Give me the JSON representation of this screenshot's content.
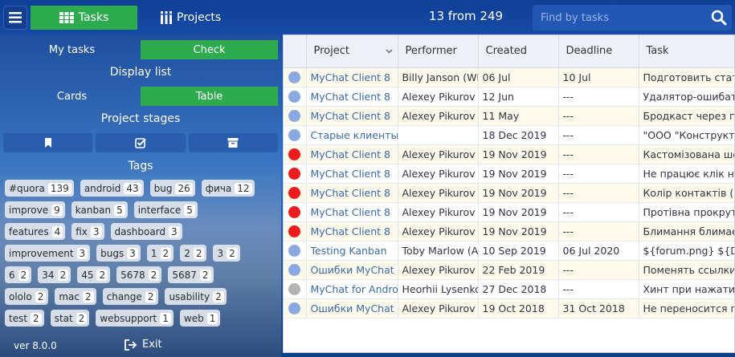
{
  "topbar": {
    "tasks_label": "Tasks",
    "projects_label": "Projects",
    "counter": "13 from 249",
    "search_placeholder": "Find by tasks"
  },
  "sidebar": {
    "my_tasks": "My tasks",
    "check": "Check",
    "display_list": "Display list",
    "cards": "Cards",
    "table": "Table",
    "project_stages": "Project stages",
    "tags_title": "Tags",
    "version": "ver 8.0.0",
    "exit": "Exit"
  },
  "tags": [
    [
      {
        "name": "#quora",
        "count": "139"
      },
      {
        "name": "android",
        "count": "43"
      },
      {
        "name": "bug",
        "count": "26"
      },
      {
        "name": "фича",
        "count": "12"
      }
    ],
    [
      {
        "name": "improve",
        "count": "9"
      },
      {
        "name": "kanban",
        "count": "5"
      },
      {
        "name": "interface",
        "count": "5"
      }
    ],
    [
      {
        "name": "features",
        "count": "4"
      },
      {
        "name": "fix",
        "count": "3"
      },
      {
        "name": "dashboard",
        "count": "3"
      }
    ],
    [
      {
        "name": "improvement",
        "count": "3"
      },
      {
        "name": "bugs",
        "count": "3"
      },
      {
        "name": "1",
        "count": "2"
      },
      {
        "name": "2",
        "count": "2"
      },
      {
        "name": "3",
        "count": "2"
      }
    ],
    [
      {
        "name": "6",
        "count": "2"
      },
      {
        "name": "34",
        "count": "2"
      },
      {
        "name": "45",
        "count": "2"
      },
      {
        "name": "5678",
        "count": "2"
      },
      {
        "name": "5687",
        "count": "2"
      }
    ],
    [
      {
        "name": "ololo",
        "count": "2"
      },
      {
        "name": "mac",
        "count": "2"
      },
      {
        "name": "change",
        "count": "2"
      },
      {
        "name": "usability",
        "count": "2"
      }
    ],
    [
      {
        "name": "test",
        "count": "2"
      },
      {
        "name": "stat",
        "count": "2"
      },
      {
        "name": "websupport",
        "count": "1"
      },
      {
        "name": "web",
        "count": "1"
      }
    ]
  ],
  "table": {
    "columns": [
      "Project",
      "Performer",
      "Created",
      "Deadline",
      "Task"
    ],
    "rows": [
      {
        "status": "#8aa9e0",
        "project": "MyChat Client 8",
        "performer": "Billy Janson (WE",
        "created": "06 Jul",
        "deadline": "10 Jul",
        "task": "Подготовить стат"
      },
      {
        "status": "#8aa9e0",
        "project": "MyChat Client 8",
        "performer": "Alexey Pikurov",
        "created": "12 Jun",
        "deadline": "---",
        "task": "Удалятор-ошибат"
      },
      {
        "status": "#8aa9e0",
        "project": "MyChat Client 8",
        "performer": "Alexey Pikurov",
        "created": "11 May",
        "deadline": "---",
        "task": "Бродкаст через п"
      },
      {
        "status": "#8aa9e0",
        "project": "Старые клиенты,",
        "performer": "",
        "created": "18 Dec 2019",
        "deadline": "---",
        "task": "\"ООО \"Конструкти"
      },
      {
        "status": "#ee1c1c",
        "project": "MyChat Client 8",
        "performer": "Alexey Pikurov",
        "created": "19 Nov 2019",
        "deadline": "---",
        "task": "Кастомізована ше"
      },
      {
        "status": "#ee1c1c",
        "project": "MyChat Client 8",
        "performer": "Alexey Pikurov",
        "created": "19 Nov 2019",
        "deadline": "---",
        "task": "Не працює клік на"
      },
      {
        "status": "#ee1c1c",
        "project": "MyChat Client 8",
        "performer": "Alexey Pikurov",
        "created": "19 Nov 2019",
        "deadline": "---",
        "task": "Колір контактів (с"
      },
      {
        "status": "#ee1c1c",
        "project": "MyChat Client 8",
        "performer": "Alexey Pikurov",
        "created": "19 Nov 2019",
        "deadline": "---",
        "task": "Протівна прокрут"
      },
      {
        "status": "#ee1c1c",
        "project": "MyChat Client 8",
        "performer": "Alexey Pikurov",
        "created": "19 Nov 2019",
        "deadline": "---",
        "task": "Блимання блимає"
      },
      {
        "status": "#8aa9e0",
        "project": "Testing Kanban",
        "performer": "Toby Marlow (Ar",
        "created": "10 Sep 2019",
        "deadline": "06 Jul 2020",
        "task": "${forum.png} ${Dis"
      },
      {
        "status": "#8aa9e0",
        "project": "Ошибки MyChat C",
        "performer": "Alexey Pikurov",
        "created": "22 Feb 2019",
        "deadline": "---",
        "task": "Поменять ссылки"
      },
      {
        "status": "#b3b3b3",
        "project": "MyChat for Androi",
        "performer": "Heorhii Lysenko",
        "created": "27 Dec 2018",
        "deadline": "---",
        "task": "Хинт при нажатии"
      },
      {
        "status": "#8aa9e0",
        "project": "Ошибки MyChat C",
        "performer": "Alexey Pikurov",
        "created": "19 Oct 2018",
        "deadline": "31 Oct 2018",
        "task": "Не переносится п"
      }
    ]
  },
  "colors": {
    "accent_green": "#2eaa4f",
    "topbar_blue": "#1d56b4"
  },
  "icons": [
    "menu-icon",
    "grid-icon",
    "projects-icon",
    "search-icon",
    "bookmark-icon",
    "checkbox-icon",
    "archive-icon",
    "exit-icon",
    "sort-chevron-icon"
  ]
}
